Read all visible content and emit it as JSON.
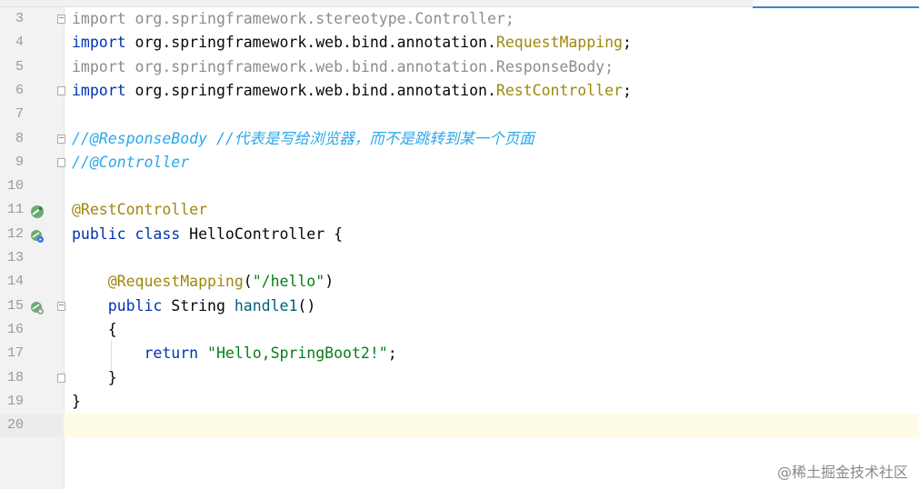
{
  "lines": [
    {
      "n": "3",
      "fold": "open",
      "icon": "",
      "tokens": [
        {
          "t": "import ",
          "c": "gray"
        },
        {
          "t": "org.springframework.stereotype.Controller;",
          "c": "gray"
        }
      ]
    },
    {
      "n": "4",
      "fold": "",
      "icon": "",
      "tokens": [
        {
          "t": "import ",
          "c": "kw"
        },
        {
          "t": "org.springframework.web.bind.annotation.",
          "c": "plain"
        },
        {
          "t": "RequestMapping",
          "c": "ann"
        },
        {
          "t": ";",
          "c": "plain"
        }
      ]
    },
    {
      "n": "5",
      "fold": "",
      "icon": "",
      "tokens": [
        {
          "t": "import ",
          "c": "gray"
        },
        {
          "t": "org.springframework.web.bind.annotation.ResponseBody;",
          "c": "gray"
        }
      ]
    },
    {
      "n": "6",
      "fold": "close",
      "icon": "",
      "tokens": [
        {
          "t": "import ",
          "c": "kw"
        },
        {
          "t": "org.springframework.web.bind.annotation.",
          "c": "plain"
        },
        {
          "t": "RestController",
          "c": "ann"
        },
        {
          "t": ";",
          "c": "plain"
        }
      ]
    },
    {
      "n": "7",
      "fold": "",
      "icon": "",
      "tokens": []
    },
    {
      "n": "8",
      "fold": "open",
      "icon": "",
      "tokens": [
        {
          "t": "//@ResponseBody //代表是写给浏览器，而不是跳转到某一个页面",
          "c": "cmt"
        }
      ]
    },
    {
      "n": "9",
      "fold": "close",
      "icon": "",
      "tokens": [
        {
          "t": "//@Controller",
          "c": "cmt"
        }
      ]
    },
    {
      "n": "10",
      "fold": "",
      "icon": "",
      "tokens": []
    },
    {
      "n": "11",
      "fold": "",
      "icon": "bean",
      "tokens": [
        {
          "t": "@RestController",
          "c": "ann"
        }
      ]
    },
    {
      "n": "12",
      "fold": "",
      "icon": "run",
      "tokens": [
        {
          "t": "public ",
          "c": "kw"
        },
        {
          "t": "class ",
          "c": "kw"
        },
        {
          "t": "HelloController {",
          "c": "plain"
        }
      ]
    },
    {
      "n": "13",
      "fold": "",
      "icon": "",
      "tokens": []
    },
    {
      "n": "14",
      "fold": "",
      "icon": "",
      "tokens": [
        {
          "t": "    ",
          "c": "plain"
        },
        {
          "t": "@RequestMapping",
          "c": "ann"
        },
        {
          "t": "(",
          "c": "plain"
        },
        {
          "t": "\"/hello\"",
          "c": "str"
        },
        {
          "t": ")",
          "c": "plain"
        }
      ]
    },
    {
      "n": "15",
      "fold": "open",
      "icon": "web",
      "tokens": [
        {
          "t": "    ",
          "c": "plain"
        },
        {
          "t": "public ",
          "c": "kw"
        },
        {
          "t": "String ",
          "c": "plain"
        },
        {
          "t": "handle1",
          "c": "meth"
        },
        {
          "t": "()",
          "c": "plain"
        }
      ]
    },
    {
      "n": "16",
      "fold": "",
      "icon": "",
      "tokens": [
        {
          "t": "    {",
          "c": "plain"
        }
      ]
    },
    {
      "n": "17",
      "fold": "",
      "icon": "",
      "tokens": [
        {
          "t": "        ",
          "c": "plain"
        },
        {
          "t": "return ",
          "c": "kw"
        },
        {
          "t": "\"Hello,SpringBoot2!\"",
          "c": "str"
        },
        {
          "t": ";",
          "c": "plain"
        }
      ]
    },
    {
      "n": "18",
      "fold": "close",
      "icon": "",
      "tokens": [
        {
          "t": "    }",
          "c": "plain"
        }
      ]
    },
    {
      "n": "19",
      "fold": "",
      "icon": "",
      "tokens": [
        {
          "t": "}",
          "c": "plain"
        }
      ]
    },
    {
      "n": "20",
      "fold": "",
      "icon": "",
      "current": true,
      "tokens": []
    }
  ],
  "watermark": "@稀土掘金技术社区",
  "colors": {
    "keyword": "#0033b3",
    "annotation": "#9e880d",
    "string": "#067d17",
    "comment": "#2ca7ea",
    "method": "#00627a",
    "current_line": "#fefbe6"
  }
}
